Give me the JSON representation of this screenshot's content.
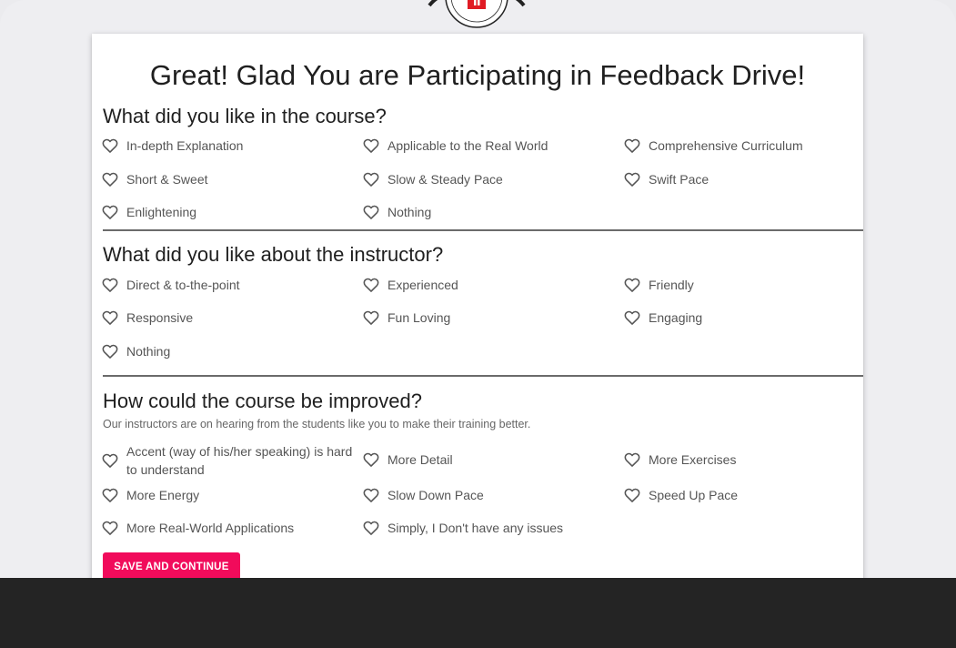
{
  "page": {
    "title": "Great! Glad You are Participating in Feedback Drive!"
  },
  "sections": [
    {
      "title": "What did you like in the course?",
      "subtitle": "",
      "options": [
        "In-depth Explanation",
        "Applicable to the Real World",
        "Comprehensive Curriculum",
        "Short & Sweet",
        "Slow & Steady Pace",
        "Swift Pace",
        "Enlightening",
        "Nothing"
      ]
    },
    {
      "title": "What did you like about the instructor?",
      "subtitle": "",
      "options": [
        "Direct & to-the-point",
        "Experienced",
        "Friendly",
        "Responsive",
        "Fun Loving",
        "Engaging",
        "Nothing"
      ]
    },
    {
      "title": "How could the course be improved?",
      "subtitle": "Our instructors are on hearing from the students like you to make their training better.",
      "options": [
        "Accent (way of his/her speaking) is hard to understand",
        "More Detail",
        "More Exercises",
        "More Energy",
        "Slow Down Pace",
        "Speed Up Pace",
        "More Real-World Applications",
        "Simply, I Don't have any issues"
      ]
    }
  ],
  "actions": {
    "save_label": "SAVE AND CONTINUE"
  },
  "colors": {
    "accent": "#f10b5b",
    "heart_outline": "#555555",
    "bottom_bar": "#242424"
  },
  "icons": {
    "option": "heart-outline-icon",
    "logo": "brand-logo"
  }
}
